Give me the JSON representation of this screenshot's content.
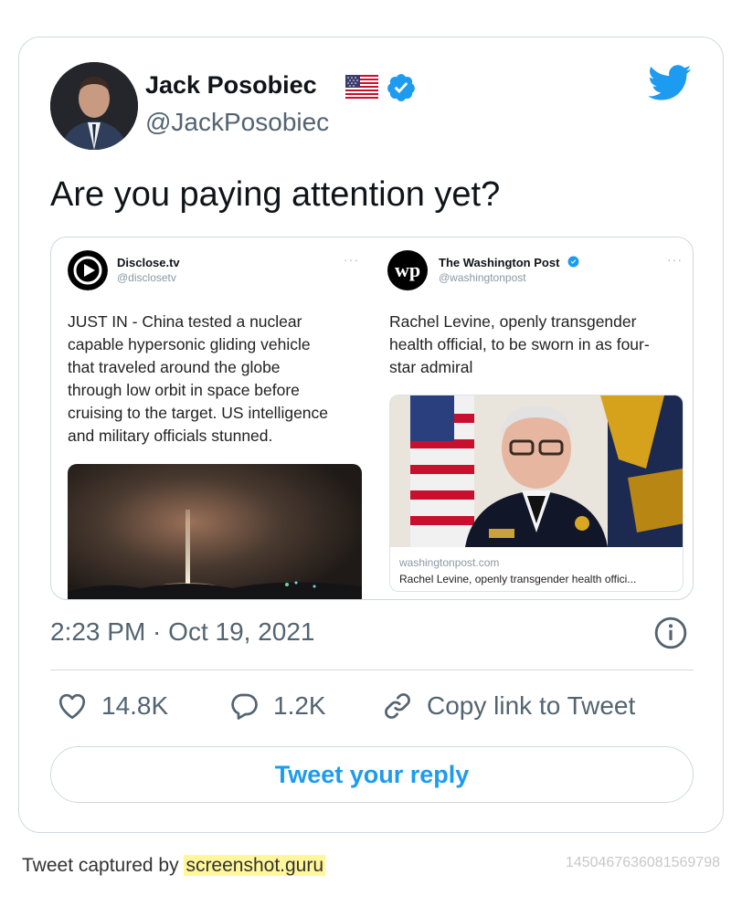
{
  "author": {
    "name": "Jack Posobiec",
    "handle": "@JackPosobiec",
    "verified": true,
    "flag_icon": "us-flag-icon",
    "avatar_icon": "avatar"
  },
  "tweet": {
    "text": "Are you paying attention yet?",
    "timestamp": "2:23 PM · Oct 19, 2021"
  },
  "embedded": {
    "left": {
      "name": "Disclose.tv",
      "handle": "@disclosetv",
      "text_lines": [
        "JUST IN - China tested a nuclear",
        "capable hypersonic gliding vehicle",
        "that traveled around the globe",
        "through low orbit in space before",
        "cruising to the target. US intelligence",
        "and military officials stunned."
      ]
    },
    "right": {
      "name": "The Washington Post",
      "handle": "@washingtonpost",
      "logo_text": "wp",
      "text_lines": [
        "Rachel Levine, openly transgender",
        "health official, to be sworn in as four-",
        "star admiral"
      ],
      "link_domain": "washingtonpost.com",
      "link_title": "Rachel Levine, openly transgender health offici..."
    }
  },
  "actions": {
    "likes": "14.8K",
    "replies": "1.2K",
    "copy_link": "Copy link to Tweet"
  },
  "reply_button": "Tweet your reply",
  "footer": {
    "captured_by": "Tweet captured by ",
    "site": "screenshot.guru",
    "tweet_id": "1450467636081569798"
  },
  "colors": {
    "accent": "#1d9bf0",
    "secondary_text": "#536471",
    "border": "#cfd9de",
    "highlight": "#fff799"
  }
}
